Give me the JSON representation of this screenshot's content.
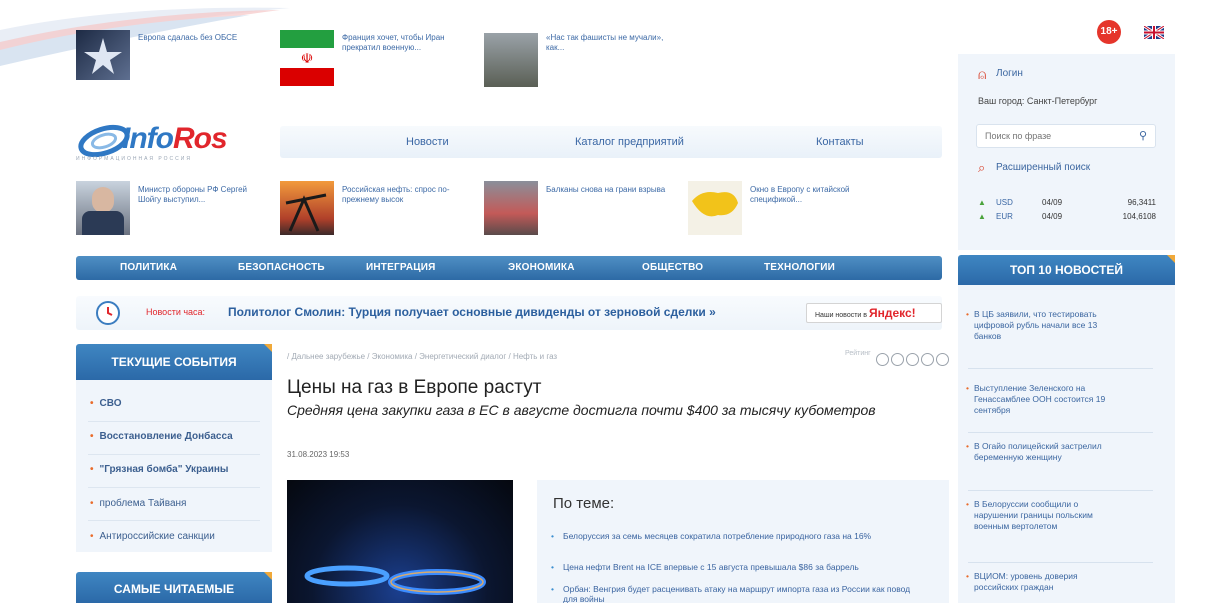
{
  "top_news": [
    {
      "text": "Европа сдалась без ОБСЕ"
    },
    {
      "text": "Франция хочет, чтобы Иран прекратил военную..."
    },
    {
      "text": "«Нас так фашисты не мучали», как..."
    }
  ],
  "age_badge": "18+",
  "logo": {
    "name_part1": "Info",
    "name_part2": "Ros",
    "tagline": "ИНФОРМАЦИОННАЯ  РОССИЯ"
  },
  "nav": [
    "Новости",
    "Каталог предприятий",
    "Контакты"
  ],
  "news_row2": [
    {
      "text": "Министр обороны РФ Сергей Шойгу выступил..."
    },
    {
      "text": "Российская нефть: спрос по-прежнему высок"
    },
    {
      "text": "Балканы снова на грани взрыва"
    },
    {
      "text": "Окно в Европу с китайской спецификой..."
    }
  ],
  "categories": [
    "ПОЛИТИКА",
    "БЕЗОПАСНОСТЬ",
    "ИНТЕГРАЦИЯ",
    "ЭКОНОМИКА",
    "ОБЩЕСТВО",
    "ТЕХНОЛОГИИ"
  ],
  "hour_news": {
    "label": "Новости часа:",
    "headline": "Политолог Смолин: Турция получает основные дивиденды от зерновой сделки »",
    "yandex_prefix": "Наши новости в",
    "yandex": "Яндекс!"
  },
  "user": {
    "login": "Логин",
    "city": "Ваш город: Санкт-Петербург",
    "search_placeholder": "Поиск по фразе",
    "advanced": "Расширенный поиск"
  },
  "currency": [
    {
      "code": "USD",
      "date": "04/09",
      "value": "96,3411"
    },
    {
      "code": "EUR",
      "date": "04/09",
      "value": "104,6108"
    }
  ],
  "left": {
    "current_title": "ТЕКУЩИЕ СОБЫТИЯ",
    "current_items": [
      "СВО",
      "Восстановление Донбасса",
      "\"Грязная бомба\" Украины",
      "проблема Тайваня",
      "Антироссийские санкции"
    ],
    "popular_title": "САМЫЕ ЧИТАЕМЫЕ"
  },
  "article": {
    "breadcrumb": "/ Дальнее зарубежье / Экономика / Энергетический диалог / Нефть и газ",
    "rating_label": "Рейтинг",
    "title": "Цены на газ в Европе растут",
    "subtitle": "Средняя цена закупки газа в ЕС в августе достигла почти $400 за тысячу кубометров",
    "date": "31.08.2023 19:53",
    "related_title": "По теме:",
    "related": [
      "Белоруссия за семь месяцев сократила потребление природного газа на 16%",
      "Цена нефти Brent на ICE впервые с 15 августа превышала $86 за баррель",
      "Орбан: Венгрия будет расценивать атаку на маршрут импорта газа из России как повод для войны"
    ]
  },
  "top10": {
    "title": "ТОП 10 НОВОСТЕЙ",
    "items": [
      "В ЦБ заявили, что тестировать цифровой рубль начали все 13 банков",
      "Выступление Зеленского на Генассамблее ООН состоится 19 сентября",
      "В Огайо полицейский застрелил беременную женщину",
      "В Белоруссии сообщили о нарушении границы польским военным вертолетом",
      "ВЦИОМ: уровень доверия российских граждан"
    ]
  },
  "colors": {
    "accent": "#2d6aa5",
    "bullet": "#e96c2c",
    "badge": "#e5352b"
  }
}
